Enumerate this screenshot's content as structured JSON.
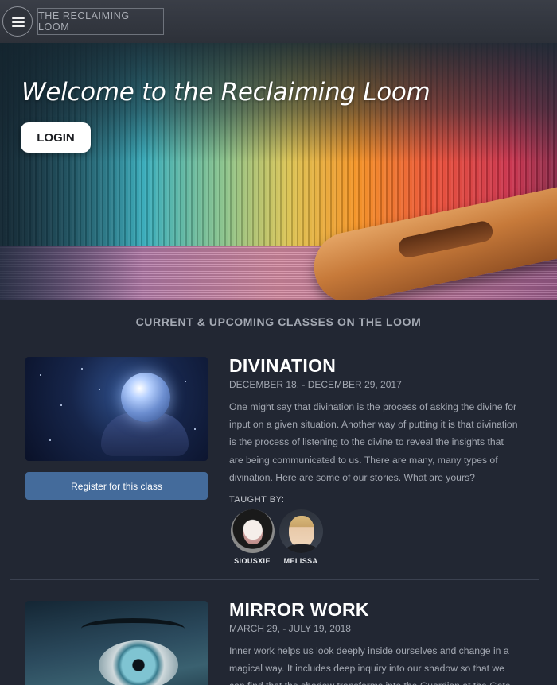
{
  "header": {
    "site_title": "THE RECLAIMING LOOM",
    "menu_icon": "hamburger-menu-icon"
  },
  "hero": {
    "heading": "Welcome to the Reclaiming Loom",
    "login_label": "LOGIN"
  },
  "section": {
    "heading": "CURRENT & UPCOMING CLASSES ON THE LOOM"
  },
  "classes": [
    {
      "title": "DIVINATION",
      "dates": "DECEMBER 18, - DECEMBER 29, 2017",
      "description": "One might say that divination is the process of asking the divine for input on a given situation. Another way of putting it is that divination is the process of listening to the divine to reveal the insights that are being communicated to us. There are many, many types of divination. Here are some of our stories. What are yours?",
      "register_label": "Register for this class",
      "taught_by_label": "TAUGHT BY:",
      "teachers": [
        {
          "name": "SIOUSXIE"
        },
        {
          "name": "MELISSA"
        }
      ]
    },
    {
      "title": "MIRROR WORK",
      "dates": "MARCH 29, - JULY 19, 2018",
      "description": "Inner work helps us look deeply inside ourselves and change in a magical way. It includes deep inquiry into our shadow so that we can find that the shadow transforms into the Guardian at the Gate."
    }
  ],
  "colors": {
    "background": "#222733",
    "register_button": "#446b9b",
    "topbar": "#353943"
  }
}
